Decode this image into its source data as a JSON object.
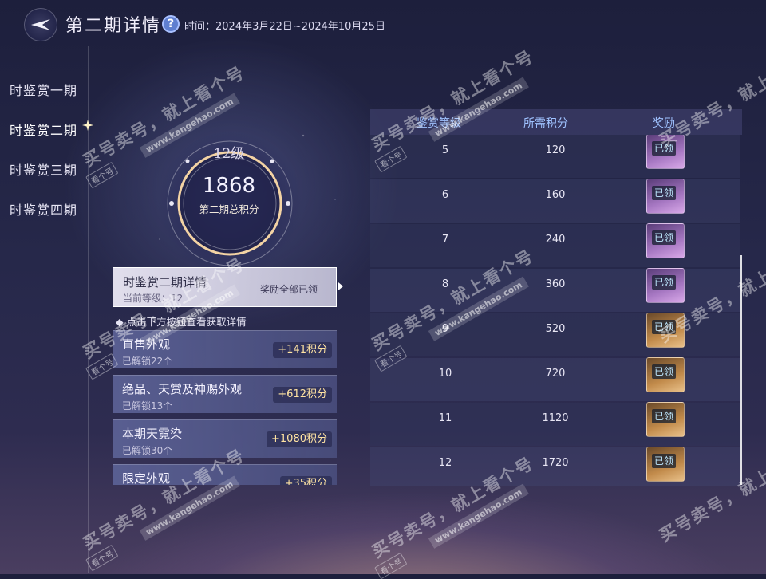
{
  "header": {
    "title": "第二期详情",
    "help_icon": "question-icon",
    "period": "时间：2024年3月22日~2024年10月25日"
  },
  "sidebar": {
    "items": [
      {
        "label": "时鉴赏一期",
        "active": false
      },
      {
        "label": "时鉴赏二期",
        "active": true
      },
      {
        "label": "时鉴赏三期",
        "active": false
      },
      {
        "label": "时鉴赏四期",
        "active": false
      }
    ]
  },
  "summary": {
    "level": "12级",
    "score": "1868",
    "score_label": "第二期总积分"
  },
  "detail_card": {
    "title": "时鉴赏二期详情",
    "current_level": "当前等级：12",
    "status": "奖励全部已领"
  },
  "hint": "点击下方按钮查看获取详情",
  "sources": [
    {
      "title": "直售外观",
      "unlocked": "已解锁22个",
      "points": "+141积分"
    },
    {
      "title": "绝品、天赏及神赐外观",
      "unlocked": "已解锁13个",
      "points": "+612积分"
    },
    {
      "title": "本期天霓染",
      "unlocked": "已解锁30个",
      "points": "+1080积分"
    },
    {
      "title": "限定外观",
      "unlocked": "",
      "points": "+35积分"
    }
  ],
  "table": {
    "headers": [
      "鉴赏等级",
      "所需积分",
      "奖励"
    ],
    "rows": [
      {
        "level": "5",
        "points": "120",
        "reward": "已领",
        "tier": "purple"
      },
      {
        "level": "6",
        "points": "160",
        "reward": "已领",
        "tier": "purple"
      },
      {
        "level": "7",
        "points": "240",
        "reward": "已领",
        "tier": "purple"
      },
      {
        "level": "8",
        "points": "360",
        "reward": "已领",
        "tier": "purple"
      },
      {
        "level": "9",
        "points": "520",
        "reward": "已领",
        "tier": "gold"
      },
      {
        "level": "10",
        "points": "720",
        "reward": "已领",
        "tier": "gold"
      },
      {
        "level": "11",
        "points": "1120",
        "reward": "已领",
        "tier": "gold"
      },
      {
        "level": "12",
        "points": "1720",
        "reward": "已领",
        "tier": "gold"
      }
    ]
  },
  "watermark": {
    "main": "买号卖号，就上看个号",
    "url": "www.kangehao.com",
    "badge": "看个号"
  },
  "colors": {
    "accent_blue": "#9fc2ff",
    "points_gold": "#ffe3a2",
    "reward_tag": "#bfe8ff"
  }
}
